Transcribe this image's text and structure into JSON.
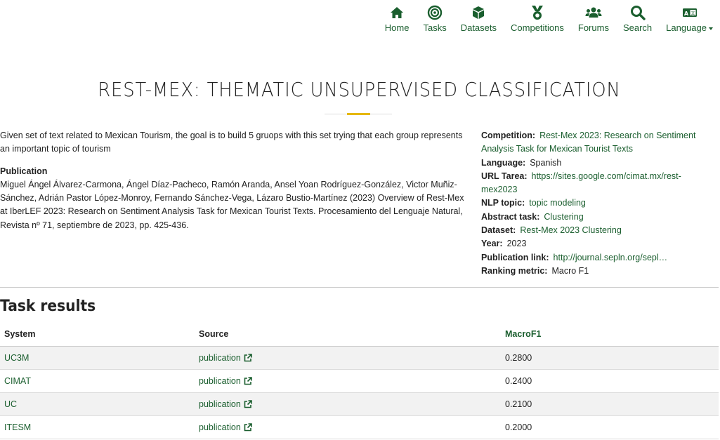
{
  "nav": {
    "items": [
      {
        "label": "Home",
        "icon": "home-icon"
      },
      {
        "label": "Tasks",
        "icon": "target-icon"
      },
      {
        "label": "Datasets",
        "icon": "cube-icon"
      },
      {
        "label": "Competitions",
        "icon": "medal-icon"
      },
      {
        "label": "Forums",
        "icon": "users-icon"
      },
      {
        "label": "Search",
        "icon": "search-icon"
      },
      {
        "label": "Language",
        "icon": "language-icon"
      }
    ]
  },
  "page": {
    "title": "REST-MEX: THEMATIC UNSUPERVISED CLASSIFICATION",
    "description": "Given set of text related to Mexican Tourism, the goal is to build 5 gruops with this set trying that each group represents an important topic of tourism",
    "publication_heading": "Publication",
    "publication_text": "Miguel Ángel Álvarez-Carmona, Ángel Díaz-Pacheco, Ramón Aranda, Ansel Yoan Rodríguez-González, Victor Muñiz-Sánchez, Adrián Pastor López-Monroy, Fernando Sánchez-Vega, Lázaro Bustio-Martínez (2023) Overview of Rest-Mex at IberLEF 2023: Research on Sentiment Analysis Task for Mexican Tourist Texts. Procesamiento del Lenguaje Natural, Revista nº 71, septiembre de 2023, pp. 425-436."
  },
  "meta": {
    "competition_label": "Competition:",
    "competition_value": "Rest-Mex 2023: Research on Sentiment Analysis Task for Mexican Tourist Texts",
    "language_label": "Language:",
    "language_value": "Spanish",
    "url_label": "URL Tarea:",
    "url_value": "https://sites.google.com/cimat.mx/rest-mex2023",
    "nlp_label": "NLP topic:",
    "nlp_value": "topic modeling",
    "abstract_label": "Abstract task:",
    "abstract_value": "Clustering",
    "dataset_label": "Dataset:",
    "dataset_value": "Rest-Mex 2023 Clustering",
    "year_label": "Year:",
    "year_value": "2023",
    "publink_label": "Publication link:",
    "publink_value": "http://journal.sepln.org/sepl…",
    "ranking_label": "Ranking metric:",
    "ranking_value": "Macro F1"
  },
  "results": {
    "title": "Task results",
    "headers": {
      "system": "System",
      "source": "Source",
      "metric": "MacroF1"
    },
    "rows": [
      {
        "system": "UC3M",
        "source": "publication",
        "score": "0.2800"
      },
      {
        "system": "CIMAT",
        "source": "publication",
        "score": "0.2400"
      },
      {
        "system": "UC",
        "source": "publication",
        "score": "0.2100"
      },
      {
        "system": "ITESM",
        "source": "publication",
        "score": "0.2000"
      }
    ]
  },
  "colors": {
    "accent": "#1a5e2e",
    "rule": "#e6b800"
  }
}
